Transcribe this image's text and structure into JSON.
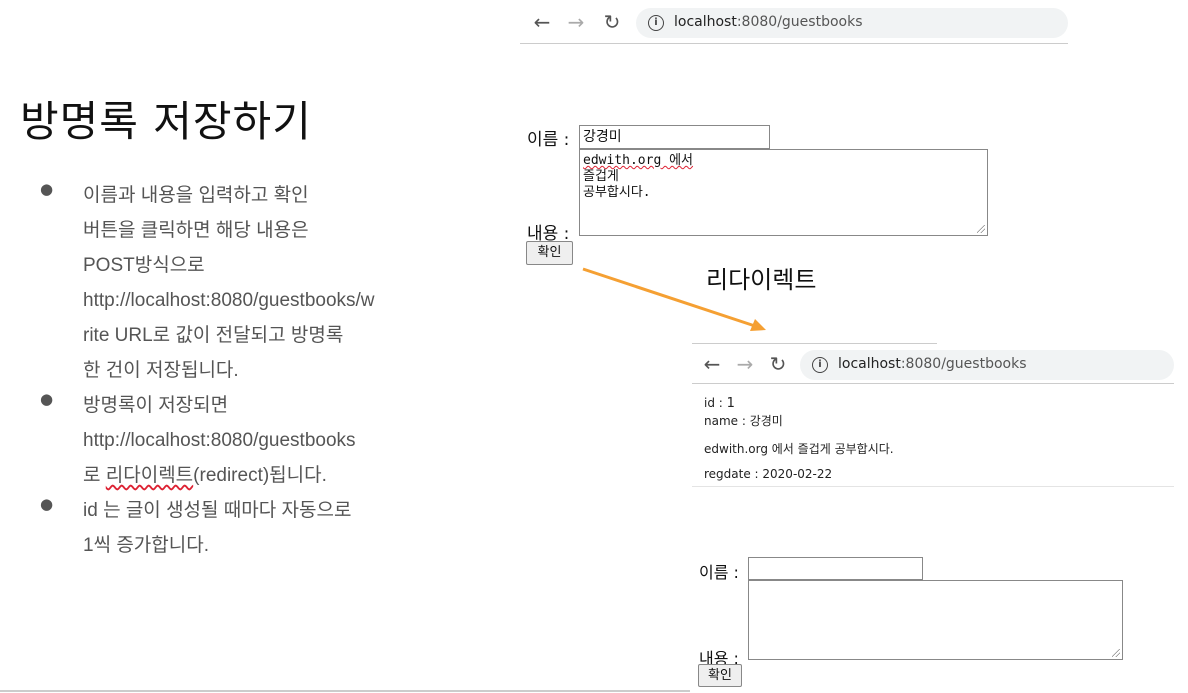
{
  "slide": {
    "title": "방명록 저장하기",
    "bullets": [
      {
        "lines": [
          "이름과 내용을 입력하고 확인",
          "버튼을 클릭하면 해당 내용은",
          "POST방식으로",
          "http://localhost:8080/guestbooks/w",
          "rite URL로 값이 전달되고 방명록",
          "한 건이 저장됩니다."
        ]
      },
      {
        "lines": [
          "방명록이 저장되면",
          "http://localhost:8080/guestbooks"
        ],
        "last_line_pre": "로 ",
        "last_line_wavy": "리다이렉트",
        "last_line_post": "(redirect)됩니다."
      },
      {
        "lines": [
          "id 는 글이 생성될 때마다 자동으로",
          "1씩 증가합니다."
        ]
      }
    ]
  },
  "browser_top": {
    "url_host": "localhost",
    "url_rest": ":8080/guestbooks"
  },
  "form_top": {
    "name_label": "이름 :",
    "name_value": "강경미",
    "content_label": "내용 :",
    "content_lines": [
      "edwith.org 에서",
      "즐겁게",
      "공부합시다."
    ],
    "submit_label": "확인"
  },
  "redirect_label": "리다이렉트",
  "arrow_color": "#f5a033",
  "browser_bottom": {
    "url_host": "localhost",
    "url_rest": ":8080/guestbooks"
  },
  "record": {
    "id_label": "id :",
    "id_value": "1",
    "name_line": "name : 강경미",
    "content_line": "edwith.org 에서 즐겁게 공부합시다.",
    "regdate_line": "regdate : 2020-02-22"
  },
  "form_bottom": {
    "name_label": "이름 :",
    "name_value": "",
    "content_label": "내용 :",
    "submit_label": "확인"
  }
}
